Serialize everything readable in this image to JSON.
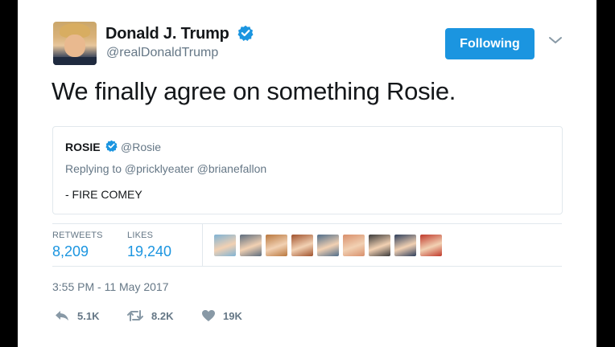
{
  "tweet": {
    "author_name": "Donald J. Trump",
    "author_handle": "@realDonaldTrump",
    "follow_label": "Following",
    "text": "We finally agree on something Rosie.",
    "timestamp": "3:55 PM - 11 May 2017"
  },
  "quoted": {
    "author_name": "ROSIE",
    "author_handle": "@Rosie",
    "reply_text": "Replying to @pricklyeater @brianefallon",
    "body": "- FIRE COMEY"
  },
  "stats": {
    "retweets_label": "RETWEETS",
    "retweets_value": "8,209",
    "likes_label": "LIKES",
    "likes_value": "19,240"
  },
  "liker_avatars": [
    {
      "name": "liker-avatar-1",
      "color": "#7fb3d5"
    },
    {
      "name": "liker-avatar-2",
      "color": "#5d6d7e"
    },
    {
      "name": "liker-avatar-3",
      "color": "#b9773e"
    },
    {
      "name": "liker-avatar-4",
      "color": "#a0522d"
    },
    {
      "name": "liker-avatar-5",
      "color": "#4f6d8a"
    },
    {
      "name": "liker-avatar-6",
      "color": "#d88f6b"
    },
    {
      "name": "liker-avatar-7",
      "color": "#3b3b3b"
    },
    {
      "name": "liker-avatar-8",
      "color": "#2e3f5c"
    },
    {
      "name": "liker-avatar-9",
      "color": "#c0392b"
    }
  ],
  "actions": {
    "reply_count": "5.1K",
    "retweet_count": "8.2K",
    "like_count": "19K"
  },
  "colors": {
    "accent": "#1b95e0",
    "secondary_text": "#657786",
    "primary_text": "#14171a"
  },
  "icons": [
    "verified-badge-icon",
    "chevron-down-icon",
    "reply-icon",
    "retweet-icon",
    "heart-icon"
  ]
}
